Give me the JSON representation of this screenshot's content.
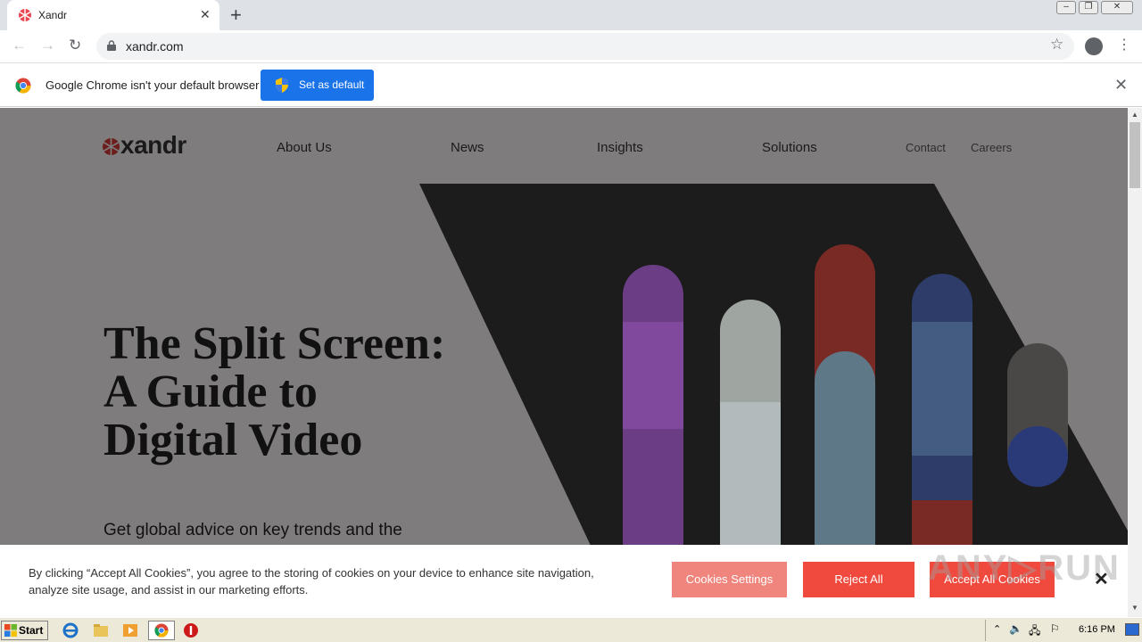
{
  "browser": {
    "tab_title": "Xandr",
    "url": "xandr.com",
    "window_controls": [
      "minimize",
      "restore",
      "close"
    ]
  },
  "infobar": {
    "message": "Google Chrome isn't your default browser",
    "button_label": "Set as default"
  },
  "site": {
    "logo_text": "xandr",
    "nav": [
      "About Us",
      "News",
      "Insights",
      "Solutions"
    ],
    "nav_secondary": [
      "Contact",
      "Careers"
    ],
    "hero_title_lines": [
      "The Split Screen:",
      "A Guide to",
      "Digital Video"
    ],
    "hero_subtitle": "Get global advice on key trends and the"
  },
  "cookie_banner": {
    "text": "By clicking “Accept All Cookies”, you agree to the storing of cookies on your device to enhance site navigation, analyze site usage, and assist in our marketing efforts.",
    "settings_label": "Cookies Settings",
    "reject_label": "Reject All",
    "accept_label": "Accept All Cookies",
    "close_symbol": "✕"
  },
  "watermark": "ANY▷RUN",
  "taskbar": {
    "start_label": "Start",
    "clock": "6:16 PM",
    "icons": [
      "ie-icon",
      "folder-icon",
      "media-icon",
      "chrome-icon",
      "stop-icon"
    ]
  },
  "colors": {
    "accent_red": "#f04a3f",
    "chrome_blue": "#1a73e8",
    "page_overlay": "#7f7c7d"
  }
}
